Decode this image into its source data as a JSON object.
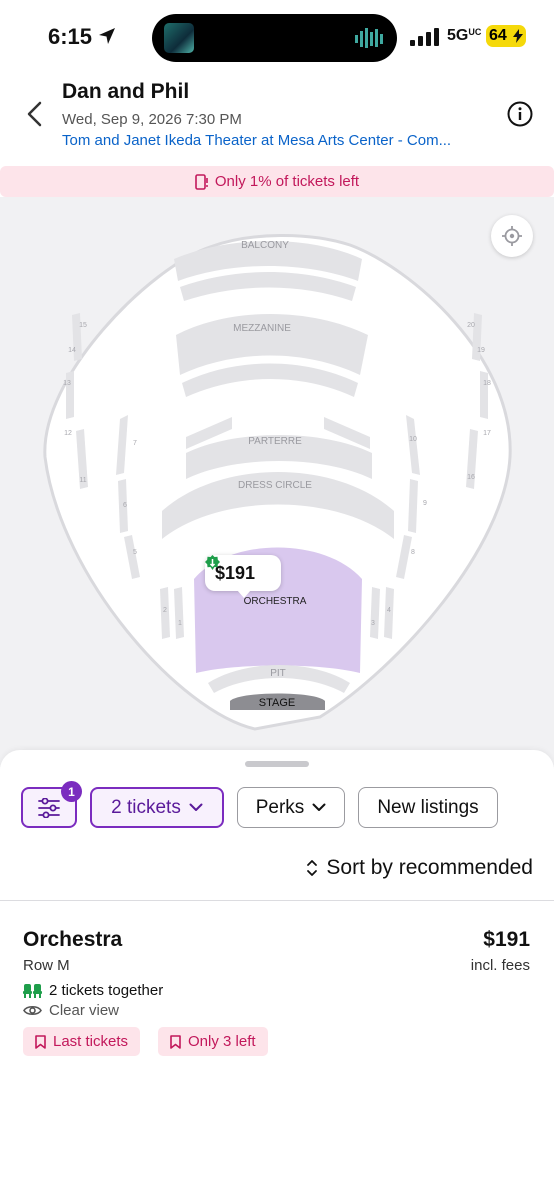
{
  "status_bar": {
    "time": "6:15",
    "network": "5G",
    "network_suffix": "UC",
    "battery": "64"
  },
  "header": {
    "title": "Dan and Phil",
    "date": "Wed, Sep 9, 2026 7:30 PM",
    "venue": "Tom and Janet Ikeda Theater at Mesa Arts Center - Com..."
  },
  "banner": {
    "text": "Only 1% of tickets left"
  },
  "map": {
    "sections": {
      "balcony": "BALCONY",
      "mezzanine": "MEZZANINE",
      "parterre": "PARTERRE",
      "dress_circle": "DRESS CIRCLE",
      "orchestra": "ORCHESTRA",
      "pit": "PIT",
      "stage": "STAGE"
    },
    "box_numbers": [
      "15",
      "14",
      "13",
      "12",
      "11",
      "7",
      "6",
      "5",
      "2",
      "1",
      "20",
      "19",
      "18",
      "17",
      "16",
      "10",
      "9",
      "8",
      "3",
      "4"
    ],
    "price_pin": "$191",
    "highlight_color": "#d9c8ee"
  },
  "filters": {
    "filter_count": "1",
    "tickets": "2 tickets",
    "perks": "Perks",
    "new_listings": "New listings"
  },
  "sort": {
    "label": "Sort by recommended"
  },
  "listing": {
    "section": "Orchestra",
    "row": "Row M",
    "price": "$191",
    "fees": "incl. fees",
    "together": "2 tickets together",
    "view": "Clear view",
    "tags": [
      "Last tickets",
      "Only 3 left"
    ]
  },
  "colors": {
    "accent": "#7b2cbf",
    "link": "#0a63c9",
    "alert": "#c2185b",
    "alert_bg": "#fde4ea"
  }
}
